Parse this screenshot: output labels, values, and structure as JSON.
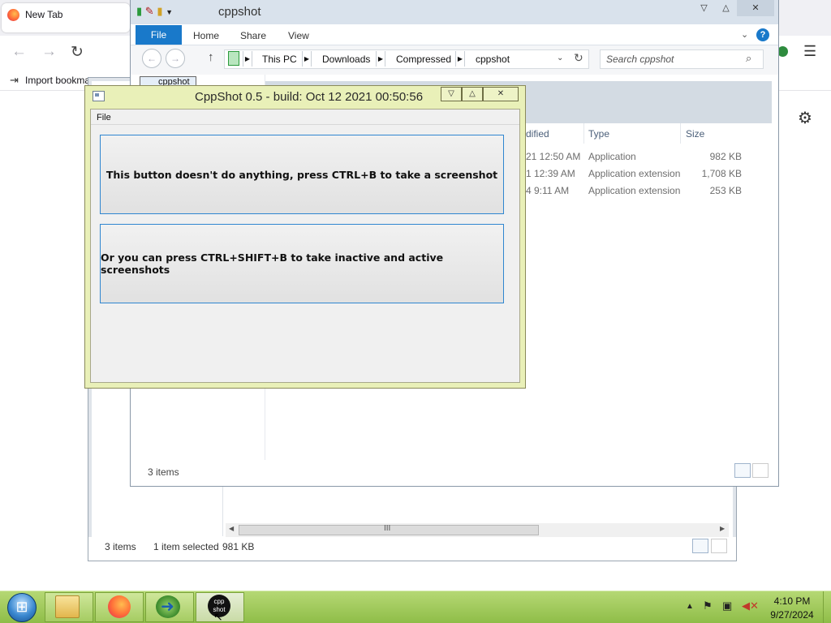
{
  "firefox": {
    "tab_title": "New Tab",
    "import_bookmarks": "Import bookmar"
  },
  "explorer_back": {
    "tab_stub": "",
    "status_items": "3 items",
    "status_selected": "1 item selected",
    "status_size": "981 KB",
    "scroll_grip": "III"
  },
  "explorer_front": {
    "title": "cppshot",
    "ribbon_tabs": [
      "File",
      "Home",
      "Share",
      "View"
    ],
    "breadcrumbs": [
      "This PC",
      "Downloads",
      "Compressed",
      "cppshot"
    ],
    "search_placeholder": "Search cppshot",
    "nav_stub": "cppshot",
    "columns": [
      "dified",
      "Type",
      "Size"
    ],
    "rows": [
      {
        "modified": "21 12:50 AM",
        "type": "Application",
        "size": "982 KB"
      },
      {
        "modified": "1 12:39 AM",
        "type": "Application extension",
        "size": "1,708 KB"
      },
      {
        "modified": "4 9:11 AM",
        "type": "Application extension",
        "size": "253 KB"
      }
    ],
    "status_count": "3 items"
  },
  "cppshot": {
    "title": "CppShot 0.5 - build: Oct 12 2021 00:50:56",
    "menu_file": "File",
    "button1": "This button doesn't do anything, press CTRL+B to take a screenshot",
    "button2": "Or you can press CTRL+SHIFT+B to take inactive and active screenshots"
  },
  "taskbar": {
    "cpp_label": "cpp shot",
    "time": "4:10 PM",
    "date": "9/27/2024"
  },
  "icons": {
    "firefox": "firefox-icon",
    "folder": "folder-icon",
    "idm": "download-manager-icon",
    "cppshot": "cppshot-icon"
  },
  "colors": {
    "taskbar": "#a5cc62",
    "explorer_accent": "#1979ca",
    "cppshot_frame": "#e9f0b8",
    "button_border": "#2f86d0"
  }
}
